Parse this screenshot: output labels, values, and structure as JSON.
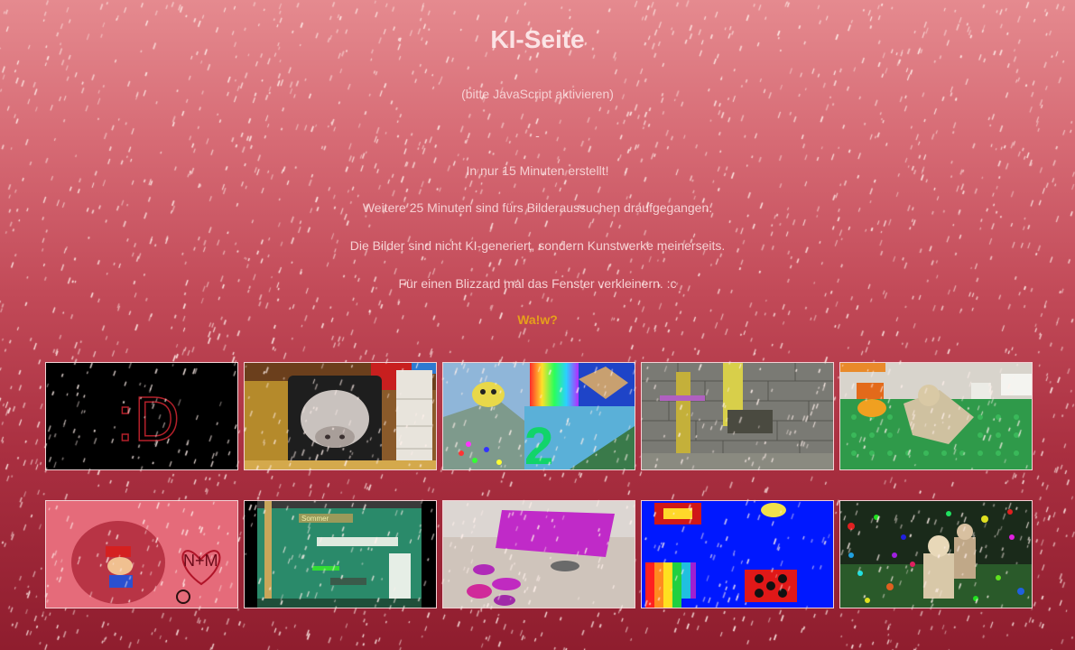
{
  "page": {
    "title": "KI-Seite",
    "js_notice": "(bitte JavaScript aktivieren)",
    "separator": "-",
    "lines": [
      "In nur 15 Minuten erstellt!",
      "Weitere 25 Minuten sind fürs Bilderaussuchen draufgegangen.",
      "Die Bilder sind nicht KI-generiert, sondern Kunstwerke meinerseits.",
      "Für einen Blizzard mal das Fenster verkleinern. :c"
    ],
    "wow_link": "Wa!w?"
  },
  "gallery": {
    "thumb1_text": ":D",
    "thumb7_text": "Sommer",
    "thumb9_text": "2",
    "thumb6_text": "N+M"
  },
  "colors": {
    "title": "#fbe3e5",
    "text": "#f6d0d3",
    "link": "#e6a01b",
    "bg_top": "#e58a8f",
    "bg_bottom": "#8f1d2e"
  }
}
